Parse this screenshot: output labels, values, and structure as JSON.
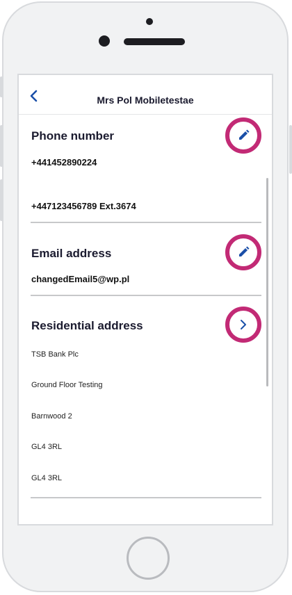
{
  "header": {
    "title": "Mrs Pol Mobiletestae"
  },
  "phone_section": {
    "heading": "Phone number",
    "primary": "+441452890224",
    "secondary": "+447123456789 Ext.3674"
  },
  "email_section": {
    "heading": "Email address",
    "value": "changedEmail5@wp.pl"
  },
  "address_section": {
    "heading": "Residential address",
    "lines": [
      "TSB Bank Plc",
      "Ground Floor Testing",
      "Barnwood 2",
      "GL4 3RL",
      "GL4 3RL"
    ]
  },
  "icons": {
    "back": "chevron-left-icon",
    "edit": "pencil-icon",
    "open": "chevron-right-icon"
  },
  "colors": {
    "accent_blue": "#1a4fa8",
    "highlight_ring": "#c22a75"
  }
}
